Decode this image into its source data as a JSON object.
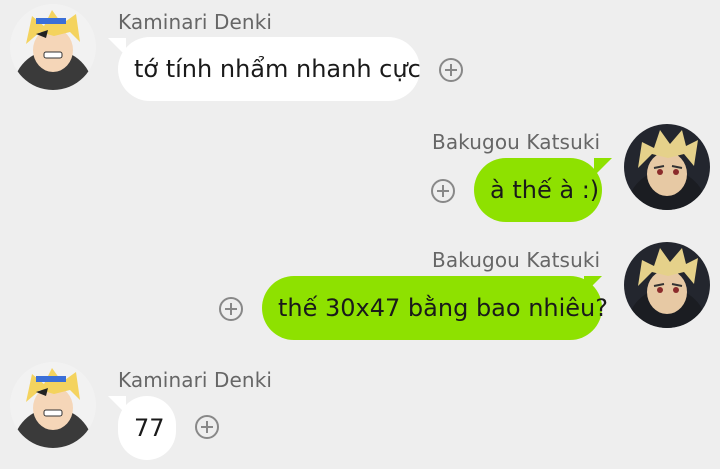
{
  "messages": [
    {
      "sender": "Kaminari Denki",
      "text": "tớ tính nhẩm nhanh cực",
      "side": "left",
      "avatar": "kaminari-avatar"
    },
    {
      "sender": "Bakugou Katsuki",
      "text": "à thế à :)",
      "side": "right",
      "avatar": "bakugou-avatar"
    },
    {
      "sender": "Bakugou Katsuki",
      "text": "thế 30x47 bằng bao nhiêu?",
      "side": "right",
      "avatar": "bakugou-avatar"
    },
    {
      "sender": "Kaminari Denki",
      "text": "77",
      "side": "left",
      "avatar": "kaminari-avatar"
    }
  ],
  "reaction_icon": "add-reaction-icon",
  "colors": {
    "background": "#eeeeee",
    "incoming_bubble": "#ffffff",
    "outgoing_bubble": "#8ee100",
    "sender_text": "#666666",
    "message_text": "#1a1a1a",
    "icon": "#888888"
  }
}
